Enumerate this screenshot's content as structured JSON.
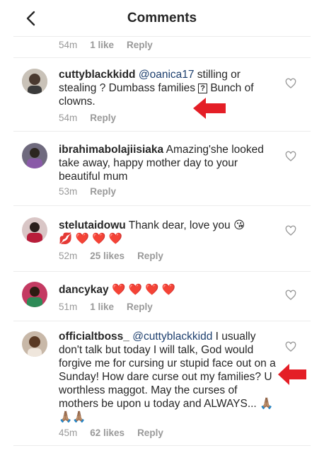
{
  "header": {
    "title": "Comments"
  },
  "prev_meta": {
    "time": "54m",
    "likes": "1 like",
    "reply": "Reply"
  },
  "comments": [
    {
      "username": "cuttyblackkidd",
      "mention": "@oanica17",
      "text_a": " stilling or stealing ? Dumbass families ",
      "box": "?",
      "text_b": " Bunch of clowns.",
      "time": "54m",
      "likes": "",
      "reply": "Reply"
    },
    {
      "username": "ibrahimabolajiisiaka",
      "text": " Amazing'she looked take away, happy mother day to your beautiful mum",
      "time": "53m",
      "likes": "",
      "reply": "Reply"
    },
    {
      "username": "stelutaidowu",
      "text": " Thank dear, love you 😘",
      "emojis": "💋 ❤️ ❤️ ❤️",
      "time": "52m",
      "likes": "25 likes",
      "reply": "Reply"
    },
    {
      "username": "dancykay",
      "emojis": " ❤️ ❤️ ❤️ ❤️",
      "time": "51m",
      "likes": "1 like",
      "reply": "Reply"
    },
    {
      "username": "officialtboss_",
      "mention": " @cuttyblackkidd",
      "text": " I usually don't talk but today I will talk, God would forgive me for cursing ur stupid face out on a Sunday! How dare curse out my families? U worthless maggot. May the curses of mothers be upon u today and ALWAYS... 🙏🏽🙏🏽🙏🏽",
      "time": "45m",
      "likes": "62 likes",
      "reply": "Reply"
    }
  ],
  "colors": {
    "accent": "#e41e26",
    "mention": "#1d3f6e",
    "meta": "#999999"
  },
  "icons": {
    "back": "chevron-left-icon",
    "like": "heart-outline-icon",
    "pointer": "red-arrow-icon"
  }
}
